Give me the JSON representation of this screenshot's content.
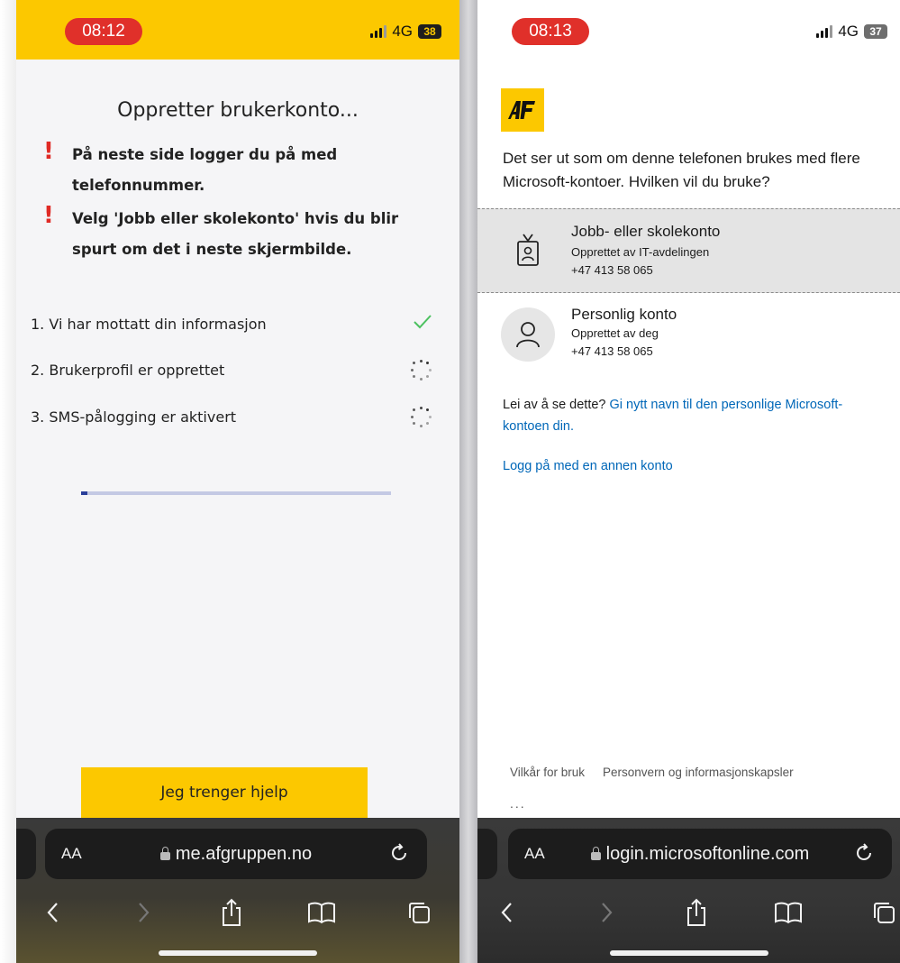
{
  "left_phone": {
    "status": {
      "time": "08:12",
      "network": "4G",
      "battery": "38"
    },
    "title": "Oppretter brukerkonto...",
    "notices": [
      "På neste side logger du på med telefonnummer.",
      "Velg 'Jobb eller skolekonto' hvis du blir spurt om det i neste skjermbilde."
    ],
    "steps": [
      {
        "label": "1. Vi har mottatt din informasjon",
        "state": "done"
      },
      {
        "label": "2. Brukerprofil er opprettet",
        "state": "loading"
      },
      {
        "label": "3. SMS-pålogging er aktivert",
        "state": "loading"
      }
    ],
    "progress_fraction": 0.02,
    "help_button": "Jeg trenger hjelp",
    "browser": {
      "aa": "AA",
      "url": "me.afgruppen.no"
    }
  },
  "right_phone": {
    "status": {
      "time": "08:13",
      "network": "4G",
      "battery": "37"
    },
    "prompt": "Det ser ut som om denne telefonen brukes med flere Microsoft-kontoer. Hvilken vil du bruke?",
    "accounts": [
      {
        "name": "Jobb- eller skolekonto",
        "created_by": "Opprettet av IT-avdelingen",
        "phone": "+47 413 58 065",
        "icon": "badge-icon",
        "selected": true
      },
      {
        "name": "Personlig konto",
        "created_by": "Opprettet av deg",
        "phone": "+47 413 58 065",
        "icon": "person-icon",
        "selected": false
      }
    ],
    "tired_prefix": "Lei av å se dette? ",
    "tired_link": "Gi nytt navn til den personlige Microsoft-kontoen din.",
    "other_account_link": "Logg på med en annen konto",
    "footer": {
      "terms": "Vilkår for bruk",
      "privacy": "Personvern og informasjonskapsler",
      "more": "..."
    },
    "browser": {
      "aa": "AA",
      "url": "login.microsoftonline.com"
    }
  },
  "colors": {
    "af_yellow": "#fcc800",
    "alert_red": "#e02a25",
    "check_green": "#4cc160",
    "ms_link_blue": "#0067b8",
    "progress_blue": "#2a3f9a"
  }
}
